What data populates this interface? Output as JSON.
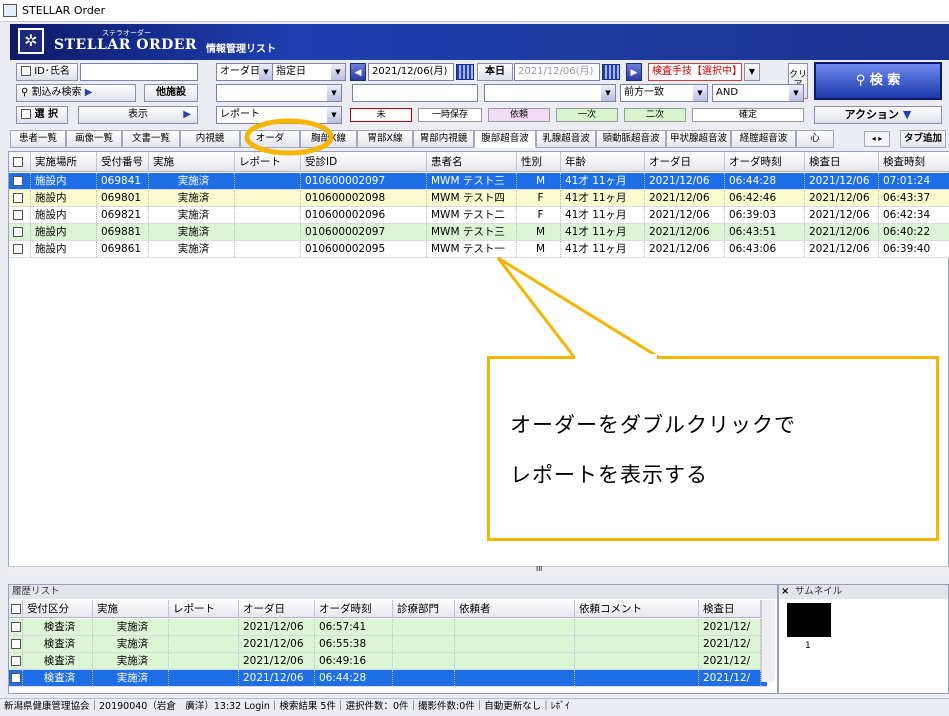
{
  "window": {
    "title": "STELLAR Order"
  },
  "banner": {
    "ruby": "ステラオーダー",
    "brand": "STELLAR ORDER",
    "subtitle": "情報管理リスト"
  },
  "toolbar": {
    "id_name": "ID･氏名",
    "date_type": "オーダ日",
    "date_mode": "指定日",
    "date_from": "2021/12/06(月)",
    "today": "本日",
    "date_to": "2021/12/06(月)",
    "inspection_tech": "検査手技【選択中】",
    "clear": "クリア",
    "search": "検 索",
    "narrow_search": "割込み検索",
    "other_facility": "他施設",
    "select": "選 択",
    "display": "表示",
    "report": "レポート",
    "match": "前方一致",
    "logic": "AND",
    "action": "アクション",
    "statuses": [
      {
        "label": "未",
        "bg": "#ffffff",
        "border": "#c00000"
      },
      {
        "label": "一時保存",
        "bg": "#ffffff",
        "border": "#999999"
      },
      {
        "label": "依頼",
        "bg": "#f4dcf6",
        "border": "#999999"
      },
      {
        "label": "一次",
        "bg": "#d8f5d0",
        "border": "#999999"
      },
      {
        "label": "二次",
        "bg": "#d8f5d0",
        "border": "#999999"
      },
      {
        "label": "確定",
        "bg": "#ffffff",
        "border": "#999999"
      }
    ]
  },
  "tabs": [
    "患者一覧",
    "画像一覧",
    "文書一覧",
    "内視鏡",
    "オーダ",
    "胸部X線",
    "胃部X線",
    "胃部内視鏡",
    "腹部超音波",
    "乳腺超音波",
    "頸動脈超音波",
    "甲状腺超音波",
    "経腟超音波",
    "心"
  ],
  "tab_add": "タブ追加",
  "grid": {
    "columns": [
      "実施場所",
      "受付番号",
      "実施",
      "レポート",
      "受診ID",
      "患者名",
      "性別",
      "年齢",
      "オーダ日",
      "オーダ時刻",
      "検査日",
      "検査時刻"
    ],
    "rows": [
      {
        "place": "施設内",
        "recept": "069841",
        "status": "実施済",
        "report": "",
        "pid": "010600002097",
        "name": "MWM テスト三",
        "sex": "M",
        "age": "41才 11ヶ月",
        "odate": "2021/12/06",
        "otime": "06:44:28",
        "edate": "2021/12/06",
        "etime": "07:01:24",
        "bg": "#1e6ee8",
        "selected": true
      },
      {
        "place": "施設内",
        "recept": "069801",
        "status": "実施済",
        "report": "",
        "pid": "010600002098",
        "name": "MWM テスト四",
        "sex": "F",
        "age": "41才 11ヶ月",
        "odate": "2021/12/06",
        "otime": "06:42:46",
        "edate": "2021/12/06",
        "etime": "06:43:37",
        "bg": "#fbfbd0",
        "selected": false
      },
      {
        "place": "施設内",
        "recept": "069821",
        "status": "実施済",
        "report": "",
        "pid": "010600002096",
        "name": "MWM テスト二",
        "sex": "F",
        "age": "41才 11ヶ月",
        "odate": "2021/12/06",
        "otime": "06:39:03",
        "edate": "2021/12/06",
        "etime": "06:42:34",
        "bg": "#ffffff",
        "selected": false
      },
      {
        "place": "施設内",
        "recept": "069881",
        "status": "実施済",
        "report": "",
        "pid": "010600002097",
        "name": "MWM テスト三",
        "sex": "M",
        "age": "41才 11ヶ月",
        "odate": "2021/12/06",
        "otime": "06:43:51",
        "edate": "2021/12/06",
        "etime": "06:40:22",
        "bg": "#dcf5d4",
        "selected": false
      },
      {
        "place": "施設内",
        "recept": "069861",
        "status": "実施済",
        "report": "",
        "pid": "010600002095",
        "name": "MWM テスト一",
        "sex": "M",
        "age": "41才 11ヶ月",
        "odate": "2021/12/06",
        "otime": "06:43:06",
        "edate": "2021/12/06",
        "etime": "06:39:40",
        "bg": "#ffffff",
        "selected": false
      }
    ]
  },
  "history": {
    "title": "履歴リスト",
    "columns": [
      "受付区分",
      "実施",
      "レポート",
      "オーダ日",
      "オーダ時刻",
      "診療部門",
      "依頼者",
      "依頼コメント",
      "検査日"
    ],
    "rows": [
      {
        "recept": "検査済",
        "status": "実施済",
        "report": "",
        "odate": "2021/12/06",
        "otime": "06:57:41",
        "dept": "",
        "requester": "",
        "comment": "",
        "edate": "2021/12/",
        "bg": "#dcf5d4",
        "selected": false
      },
      {
        "recept": "検査済",
        "status": "実施済",
        "report": "",
        "odate": "2021/12/06",
        "otime": "06:55:38",
        "dept": "",
        "requester": "",
        "comment": "",
        "edate": "2021/12/",
        "bg": "#dcf5d4",
        "selected": false
      },
      {
        "recept": "検査済",
        "status": "実施済",
        "report": "",
        "odate": "2021/12/06",
        "otime": "06:49:16",
        "dept": "",
        "requester": "",
        "comment": "",
        "edate": "2021/12/",
        "bg": "#dcf5d4",
        "selected": false
      },
      {
        "recept": "検査済",
        "status": "実施済",
        "report": "",
        "odate": "2021/12/06",
        "otime": "06:44:28",
        "dept": "",
        "requester": "",
        "comment": "",
        "edate": "2021/12/",
        "bg": "#1e6ee8",
        "selected": true
      }
    ]
  },
  "thumbnail": {
    "title": "サムネイル",
    "close": "×",
    "count": "1"
  },
  "scroll_mark": "III",
  "statusbar": "新潟県健康管理協会｜20190040（岩倉　廣洋）13:32 Login｜検索結果 5件｜選択件数：0件｜撮影件数:0件｜自動更新なし｜ﾚﾎﾞｲ",
  "callout": {
    "line1": "オーダーをダブルクリックで",
    "line2": "レポートを表示する"
  },
  "colors": {
    "accent": "#1b2b7a",
    "highlight": "#f6b500",
    "selected_row": "#1e6ee8"
  }
}
